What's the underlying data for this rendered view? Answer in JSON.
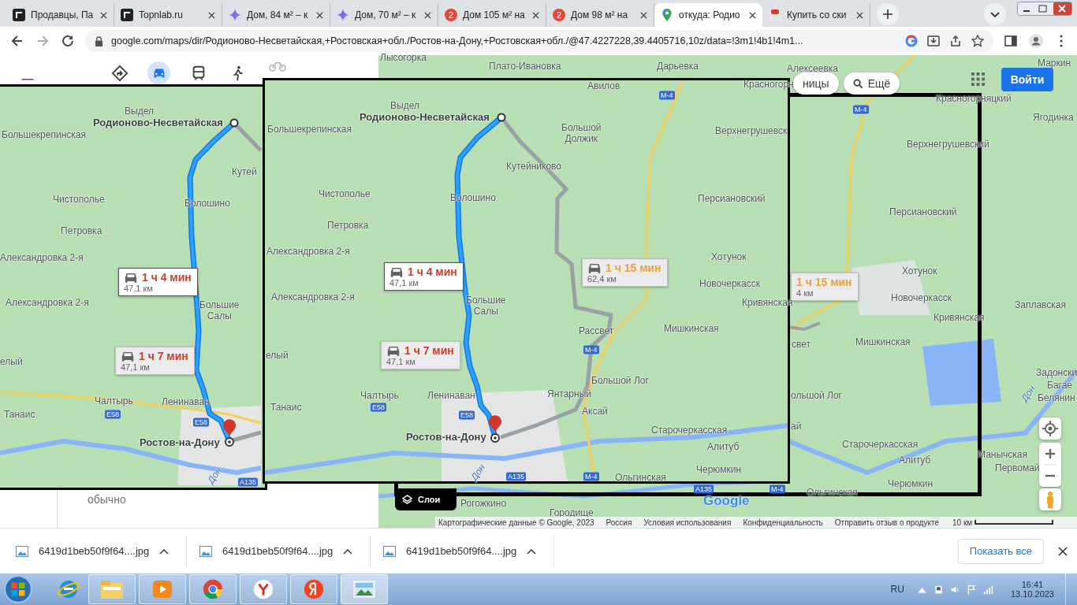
{
  "browser": {
    "tabs": [
      {
        "kind": "letter-logo",
        "title": "Продавцы, Па",
        "selected": false
      },
      {
        "kind": "letter-logo",
        "title": "Topnlab.ru",
        "selected": false
      },
      {
        "kind": "spark",
        "title": "Дом, 84 м² – к",
        "selected": false
      },
      {
        "kind": "spark",
        "title": "Дом, 70 м² – к",
        "selected": false
      },
      {
        "kind": "count",
        "count": "2",
        "title": "Дом 105 м² на",
        "selected": false
      },
      {
        "kind": "count",
        "count": "2",
        "title": "Дом 98 м² на",
        "selected": false
      },
      {
        "kind": "map-pin",
        "title": "откуда: Родио",
        "selected": true
      },
      {
        "kind": "shop",
        "title": "Купить со ски",
        "selected": false
      }
    ],
    "address": "google.com/maps/dir/Родионово-Несветайская,+Ростовская+обл./Ростов-на-Дону,+Ростовская+обл./@47.4227228,39.4405716,10z/data=!3m1!4b1!4m1..."
  },
  "sidebar": {
    "travel_modes": [
      {
        "kind": "directions",
        "selected": false
      },
      {
        "kind": "car",
        "selected": true
      },
      {
        "kind": "transit",
        "selected": false
      },
      {
        "kind": "walk",
        "selected": false
      },
      {
        "kind": "bike",
        "selected": false
      }
    ],
    "note": "обычно"
  },
  "map": {
    "labels": [
      {
        "text": "Лысогорка",
        "kind": "place"
      },
      {
        "text": "Плато-Ивановка",
        "kind": "place"
      },
      {
        "text": "Дарьевка",
        "kind": "place"
      },
      {
        "text": "Алексеевка",
        "kind": "place"
      },
      {
        "text": "Маркин",
        "kind": "place"
      },
      {
        "text": "Красногорняцкий",
        "kind": "place"
      },
      {
        "text": "Ягодинка",
        "kind": "place"
      },
      {
        "text": "Верхнегрушевский",
        "kind": "place"
      },
      {
        "text": "Персиановский",
        "kind": "place"
      },
      {
        "text": "Хотунок",
        "kind": "place"
      },
      {
        "text": "Новочеркасск",
        "kind": "place"
      },
      {
        "text": "Заплавская",
        "kind": "place"
      },
      {
        "text": "Кривянская",
        "kind": "place"
      },
      {
        "text": "свет",
        "kind": "place"
      },
      {
        "text": "Мишкинская",
        "kind": "place"
      },
      {
        "text": "Задонски",
        "kind": "place"
      },
      {
        "text": "Дон",
        "kind": "river"
      },
      {
        "text": "Багае",
        "kind": "place"
      },
      {
        "text": "ольшой Лог",
        "kind": "place"
      },
      {
        "text": "Белянин",
        "kind": "place"
      },
      {
        "text": "ай",
        "kind": "place"
      },
      {
        "text": "Старочеркасская",
        "kind": "place"
      },
      {
        "text": "Манычская",
        "kind": "place"
      },
      {
        "text": "Алитуб",
        "kind": "place"
      },
      {
        "text": "Первомай",
        "kind": "place"
      },
      {
        "text": "Черюмкин",
        "kind": "place"
      },
      {
        "text": "Ольгинская",
        "kind": "place"
      },
      {
        "text": "Рогожкино",
        "kind": "place"
      },
      {
        "text": "Городище",
        "kind": "place"
      }
    ],
    "road_signs": [
      "М-4",
      "A135",
      "М-4"
    ],
    "routes": [
      {
        "duration": "1 ч 15 мин",
        "distance": "4 км",
        "selected": false,
        "color": "#e8a33d"
      }
    ],
    "chips": [
      "ницы",
      "Ещё"
    ],
    "sign_in": "Войти",
    "layers": "Слои",
    "logo": "Google",
    "footer": [
      "Картографические данные © Google, 2023",
      "Россия",
      "Условия использования",
      "Конфиденциальность",
      "Отправить отзыв о продукте"
    ],
    "scale": "10 км"
  },
  "screenshots": [
    {
      "labels": [
        {
          "text": "Выдел",
          "kind": "place"
        },
        {
          "text": "Родионово-Несветайская",
          "kind": "endpoint"
        },
        {
          "text": "Большекрепинская",
          "kind": "place"
        },
        {
          "text": "Кутей",
          "kind": "place"
        },
        {
          "text": "Чистополье",
          "kind": "place"
        },
        {
          "text": "Волошино",
          "kind": "place"
        },
        {
          "text": "Петровка",
          "kind": "place"
        },
        {
          "text": "Александровка 2-я",
          "kind": "place"
        },
        {
          "text": "Александровка 2-я",
          "kind": "place"
        },
        {
          "text": "Большие Салы",
          "kind": "place"
        },
        {
          "text": "елый",
          "kind": "place"
        },
        {
          "text": "Чалтырь",
          "kind": "place"
        },
        {
          "text": "Ленинаван",
          "kind": "place"
        },
        {
          "text": "Танаис",
          "kind": "place"
        },
        {
          "text": "Ростов-на-Дону",
          "kind": "endpoint"
        },
        {
          "text": "Дон",
          "kind": "river"
        }
      ],
      "road_signs": [
        "E58",
        "E58",
        "A135"
      ],
      "routes": [
        {
          "duration": "1 ч 4 мин",
          "distance": "47,1 км",
          "selected": true,
          "color": "#c5402b"
        },
        {
          "duration": "1 ч 7 мин",
          "distance": "47,1 км",
          "selected": false,
          "color": "#c5402b"
        }
      ]
    },
    {
      "labels": [
        {
          "text": "Авилов",
          "kind": "place"
        },
        {
          "text": "Красногорн",
          "kind": "place"
        },
        {
          "text": "Выдел",
          "kind": "place"
        },
        {
          "text": "Родионово-Несветайская",
          "kind": "endpoint"
        },
        {
          "text": "Большекрепинская",
          "kind": "place"
        },
        {
          "text": "Большой Должик",
          "kind": "place"
        },
        {
          "text": "Верхнегрушевск",
          "kind": "place"
        },
        {
          "text": "Кутейниково",
          "kind": "place"
        },
        {
          "text": "Чистополье",
          "kind": "place"
        },
        {
          "text": "Волошино",
          "kind": "place"
        },
        {
          "text": "Персиановский",
          "kind": "place"
        },
        {
          "text": "Петровка",
          "kind": "place"
        },
        {
          "text": "Александровка 2-я",
          "kind": "place"
        },
        {
          "text": "Хотунок",
          "kind": "place"
        },
        {
          "text": "Новочеркасск",
          "kind": "place"
        },
        {
          "text": "Александровка 2-я",
          "kind": "place"
        },
        {
          "text": "Большие Салы",
          "kind": "place"
        },
        {
          "text": "Кривянская",
          "kind": "place"
        },
        {
          "text": "Мишкинская",
          "kind": "place"
        },
        {
          "text": "Рассвет",
          "kind": "place"
        },
        {
          "text": "елый",
          "kind": "place"
        },
        {
          "text": "Большой Лог",
          "kind": "place"
        },
        {
          "text": "Чалтырь",
          "kind": "place"
        },
        {
          "text": "Ленинаван",
          "kind": "place"
        },
        {
          "text": "Янтарный",
          "kind": "place"
        },
        {
          "text": "Танаис",
          "kind": "place"
        },
        {
          "text": "Аксай",
          "kind": "place"
        },
        {
          "text": "Старочеркасская",
          "kind": "place"
        },
        {
          "text": "Ростов-на-Дону",
          "kind": "endpoint"
        },
        {
          "text": "Алитуб",
          "kind": "place"
        },
        {
          "text": "Черюмкин",
          "kind": "place"
        },
        {
          "text": "Дон",
          "kind": "river"
        },
        {
          "text": "Ольгинская",
          "kind": "place"
        }
      ],
      "road_signs": [
        "М-4",
        "М-4",
        "E58",
        "E58",
        "A135",
        "М-4"
      ],
      "routes": [
        {
          "duration": "1 ч 4 мин",
          "distance": "47,1 км",
          "selected": true,
          "color": "#c5402b"
        },
        {
          "duration": "1 ч 7 мин",
          "distance": "47,1 км",
          "selected": false,
          "color": "#c5402b"
        },
        {
          "duration": "1 ч 15 мин",
          "distance": "62,4 км",
          "selected": false,
          "color": "#e8a33d"
        }
      ]
    }
  ],
  "downloads": {
    "files": [
      "6419d1beb50f9f64....jpg",
      "6419d1beb50f9f64....jpg",
      "6419d1beb50f9f64....jpg"
    ],
    "show_all": "Показать все"
  },
  "taskbar": {
    "language": "RU",
    "time": "16:41",
    "date": "13.10.2023"
  }
}
